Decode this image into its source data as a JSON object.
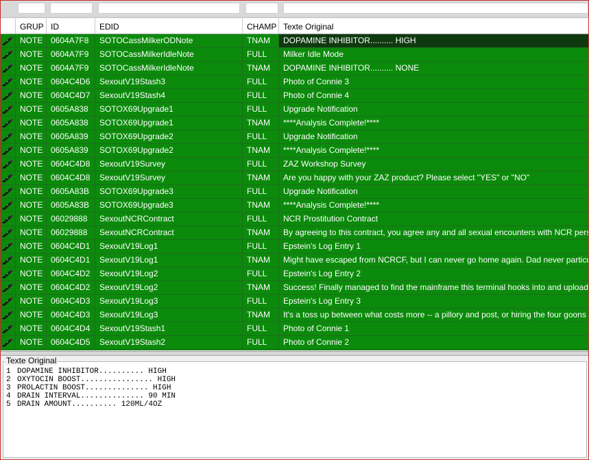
{
  "filters": [
    "",
    "",
    "",
    "",
    ""
  ],
  "columns": {
    "grup": "GRUP",
    "id": "ID",
    "edid": "EDID",
    "champ": "CHAMP",
    "texte": "Texte Original"
  },
  "rows": [
    {
      "grup": "NOTE",
      "id": "0604A7F8",
      "edid": "SOTOCassMilkerODNote",
      "champ": "TNAM",
      "texte": "DOPAMINE INHIBITOR.......... HIGH"
    },
    {
      "grup": "NOTE",
      "id": "0604A7F9",
      "edid": "SOTOCassMilkerIdleNote",
      "champ": "FULL",
      "texte": "Milker Idle Mode"
    },
    {
      "grup": "NOTE",
      "id": "0604A7F9",
      "edid": "SOTOCassMilkerIdleNote",
      "champ": "TNAM",
      "texte": "DOPAMINE INHIBITOR.......... NONE"
    },
    {
      "grup": "NOTE",
      "id": "0604C4D6",
      "edid": "SexoutV19Stash3",
      "champ": "FULL",
      "texte": "Photo of Connie 3"
    },
    {
      "grup": "NOTE",
      "id": "0604C4D7",
      "edid": "SexoutV19Stash4",
      "champ": "FULL",
      "texte": "Photo of Connie 4"
    },
    {
      "grup": "NOTE",
      "id": "0605A838",
      "edid": "SOTOX69Upgrade1",
      "champ": "FULL",
      "texte": "Upgrade Notification"
    },
    {
      "grup": "NOTE",
      "id": "0605A838",
      "edid": "SOTOX69Upgrade1",
      "champ": "TNAM",
      "texte": "****Analysis Complete!****"
    },
    {
      "grup": "NOTE",
      "id": "0605A839",
      "edid": "SOTOX69Upgrade2",
      "champ": "FULL",
      "texte": "Upgrade Notification"
    },
    {
      "grup": "NOTE",
      "id": "0605A839",
      "edid": "SOTOX69Upgrade2",
      "champ": "TNAM",
      "texte": "****Analysis Complete!****"
    },
    {
      "grup": "NOTE",
      "id": "0604C4D8",
      "edid": "SexoutV19Survey",
      "champ": "FULL",
      "texte": "ZAZ Workshop Survey"
    },
    {
      "grup": "NOTE",
      "id": "0604C4D8",
      "edid": "SexoutV19Survey",
      "champ": "TNAM",
      "texte": "Are you happy with your ZAZ product?  Please select \"YES\" or \"NO\""
    },
    {
      "grup": "NOTE",
      "id": "0605A83B",
      "edid": "SOTOX69Upgrade3",
      "champ": "FULL",
      "texte": "Upgrade Notification"
    },
    {
      "grup": "NOTE",
      "id": "0605A83B",
      "edid": "SOTOX69Upgrade3",
      "champ": "TNAM",
      "texte": "****Analysis Complete!****"
    },
    {
      "grup": "NOTE",
      "id": "06029888",
      "edid": "SexoutNCRContract",
      "champ": "FULL",
      "texte": "NCR Prostitution Contract"
    },
    {
      "grup": "NOTE",
      "id": "06029888",
      "edid": "SexoutNCRContract",
      "champ": "TNAM",
      "texte": "By agreeing to this contract, you agree any and all sexual encounters with NCR perso"
    },
    {
      "grup": "NOTE",
      "id": "0604C4D1",
      "edid": "SexoutV19Log1",
      "champ": "FULL",
      "texte": "Epstein's Log Entry 1"
    },
    {
      "grup": "NOTE",
      "id": "0604C4D1",
      "edid": "SexoutV19Log1",
      "champ": "TNAM",
      "texte": "Might have escaped from NCRCF, but I can never go home again. Dad never particul"
    },
    {
      "grup": "NOTE",
      "id": "0604C4D2",
      "edid": "SexoutV19Log2",
      "champ": "FULL",
      "texte": "Epstein's Log Entry 2"
    },
    {
      "grup": "NOTE",
      "id": "0604C4D2",
      "edid": "SexoutV19Log2",
      "champ": "TNAM",
      "texte": "Success! Finally managed to find the mainframe this terminal hooks into and upload"
    },
    {
      "grup": "NOTE",
      "id": "0604C4D3",
      "edid": "SexoutV19Log3",
      "champ": "FULL",
      "texte": "Epstein's Log Entry 3"
    },
    {
      "grup": "NOTE",
      "id": "0604C4D3",
      "edid": "SexoutV19Log3",
      "champ": "TNAM",
      "texte": "It's a toss up between what costs more -- a pillory and post, or hiring the four goons"
    },
    {
      "grup": "NOTE",
      "id": "0604C4D4",
      "edid": "SexoutV19Stash1",
      "champ": "FULL",
      "texte": "Photo of Connie 1"
    },
    {
      "grup": "NOTE",
      "id": "0604C4D5",
      "edid": "SexoutV19Stash2",
      "champ": "FULL",
      "texte": "Photo of Connie 2"
    }
  ],
  "selected_row": 0,
  "row_icon": "pen-quill-icon",
  "preview": {
    "title": "Texte Original",
    "lines": [
      {
        "n": "1",
        "text": "DOPAMINE INHIBITOR.......... HIGH"
      },
      {
        "n": "2",
        "text": "OXYTOCIN BOOST................ HIGH"
      },
      {
        "n": "3",
        "text": "PROLACTIN BOOST.............. HIGH"
      },
      {
        "n": "4",
        "text": "DRAIN INTERVAL.............. 90 MIN"
      },
      {
        "n": "5",
        "text": "DRAIN AMOUNT.......... 120ML/4OZ"
      }
    ]
  },
  "colors": {
    "row_bg": "#0b8a0b",
    "selected_bg": "#0f3a0f",
    "frame_border": "#c42b2b"
  }
}
